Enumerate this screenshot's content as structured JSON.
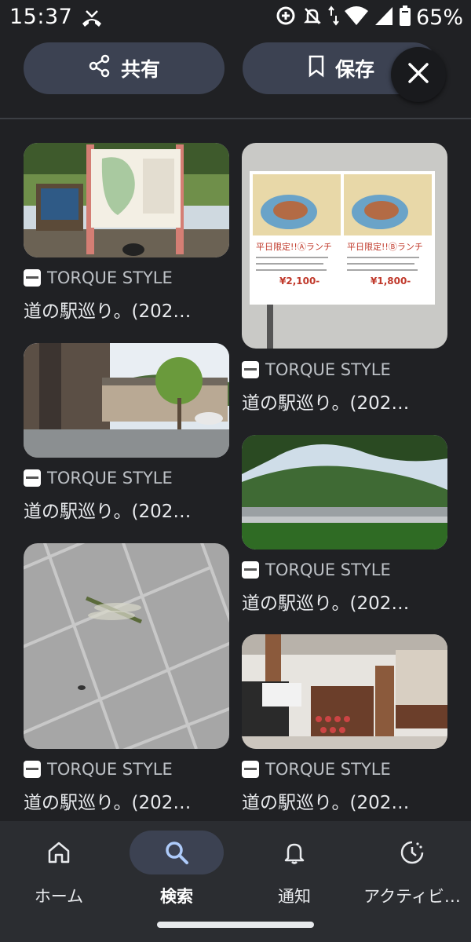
{
  "status": {
    "time": "15:37",
    "battery": "65%"
  },
  "actions": {
    "share_label": "共有",
    "save_label": "保存"
  },
  "results": [
    {
      "source": "TORQUE STYLE",
      "title": "道の駅巡り。(202…"
    },
    {
      "source": "TORQUE STYLE",
      "title": "道の駅巡り。(202…"
    },
    {
      "source": "TORQUE STYLE",
      "title": "道の駅巡り。(202…"
    },
    {
      "source": "TORQUE STYLE",
      "title": "道の駅巡り。(202…"
    },
    {
      "source": "TORQUE STYLE",
      "title": "道の駅巡り。(202…"
    },
    {
      "source": "TORQUE STYLE",
      "title": "道の駅巡り。(202…"
    }
  ],
  "menu": {
    "left_header": "平日限定!!Ⓐランチ",
    "right_header": "平日限定!!Ⓑランチ",
    "left_price": "¥2,100-",
    "right_price": "¥1,800-"
  },
  "nav": [
    {
      "label": "ホーム"
    },
    {
      "label": "検索"
    },
    {
      "label": "通知"
    },
    {
      "label": "アクティビ…"
    }
  ],
  "colors": {
    "background": "#202124",
    "pill": "#3c4252",
    "nav_bg": "#2b2d31"
  }
}
